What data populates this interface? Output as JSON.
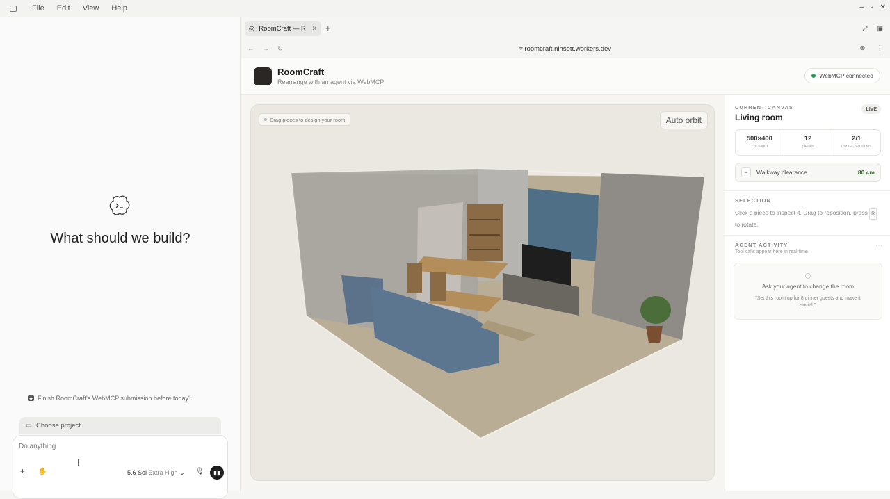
{
  "menubar": {
    "items": [
      "File",
      "Edit",
      "View",
      "Help"
    ]
  },
  "left": {
    "hero": "What should we build?",
    "task": "Finish RoomCraft's WebMCP submission before today'...",
    "project": "Choose project",
    "composer": {
      "placeholder": "Do anything",
      "model": "5.6 Sol",
      "level": "Extra High"
    }
  },
  "browser": {
    "tab_title": "RoomCraft — R",
    "url": "roomcraft.nihsett.workers.dev"
  },
  "app": {
    "title": "RoomCraft",
    "subtitle": "Rearrange with an agent via WebMCP",
    "connection": "WebMCP connected",
    "hint": "Drag pieces to design your room",
    "orbit": "Auto orbit"
  },
  "panel": {
    "canvas_label": "CURRENT CANVAS",
    "canvas_title": "Living room",
    "live": "LIVE",
    "stats": [
      {
        "value": "500×400",
        "label": "cm room"
      },
      {
        "value": "12",
        "label": "pieces"
      },
      {
        "value": "2/1",
        "label": "doors · windows"
      }
    ],
    "walkway_label": "Walkway clearance",
    "walkway_value": "80 cm",
    "selection_label": "SELECTION",
    "selection_text_1": "Click a piece to inspect it. Drag to reposition, press",
    "selection_key": "R",
    "selection_text_2": "to rotate.",
    "activity_label": "AGENT ACTIVITY",
    "activity_sub": "Tool calls appear here in real time",
    "empty_title": "Ask your agent to change the room",
    "empty_quote": "\"Set this room up for 8 dinner guests and make it social.\""
  },
  "colors": {
    "accent_dark": "#1e1e1e",
    "connected_green": "#2aa061",
    "walkway_green": "#3a6b2e"
  }
}
